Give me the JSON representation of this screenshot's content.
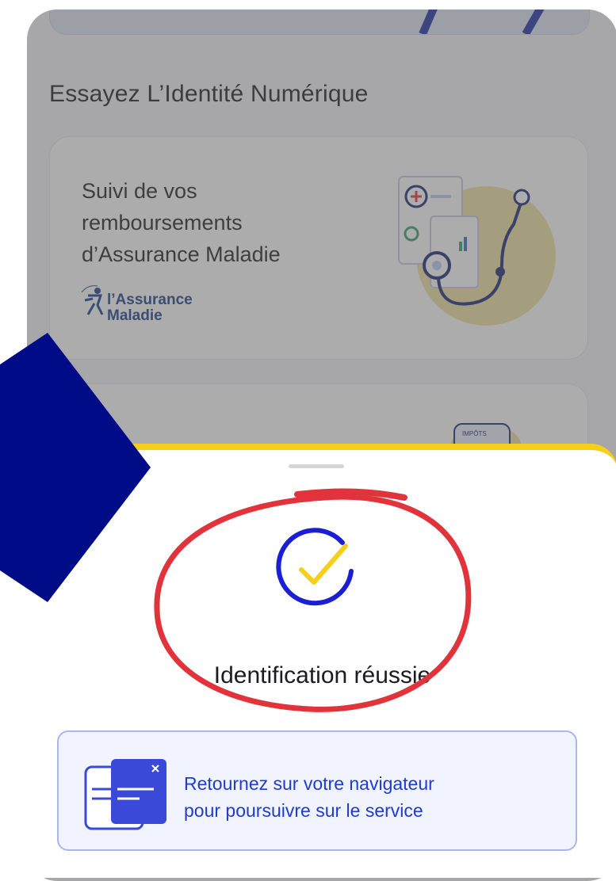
{
  "section": {
    "title": "Essayez L’Identité Numérique"
  },
  "cards": [
    {
      "title": "Suivi de vos remboursements d’Assurance Maladie",
      "logo_line1": "l’Assurance",
      "logo_line2": "Maladie",
      "illustration": "health-illustration"
    },
    {
      "title": "",
      "badge": "IMPÔTS"
    }
  ],
  "sheet": {
    "status_icon": "check-circle-icon",
    "status_text": "Identification réussie",
    "info": {
      "icon": "browser-window-icon",
      "line1": "Retournez sur votre navigateur",
      "line2": "pour poursuivre sur le service"
    }
  },
  "colors": {
    "accent_yellow": "#f7cf1b",
    "brand_blue": "#1f3bd0",
    "arrow_navy": "#000b87",
    "annotation_red": "#e0333c",
    "info_bg": "#f1f3ff"
  }
}
